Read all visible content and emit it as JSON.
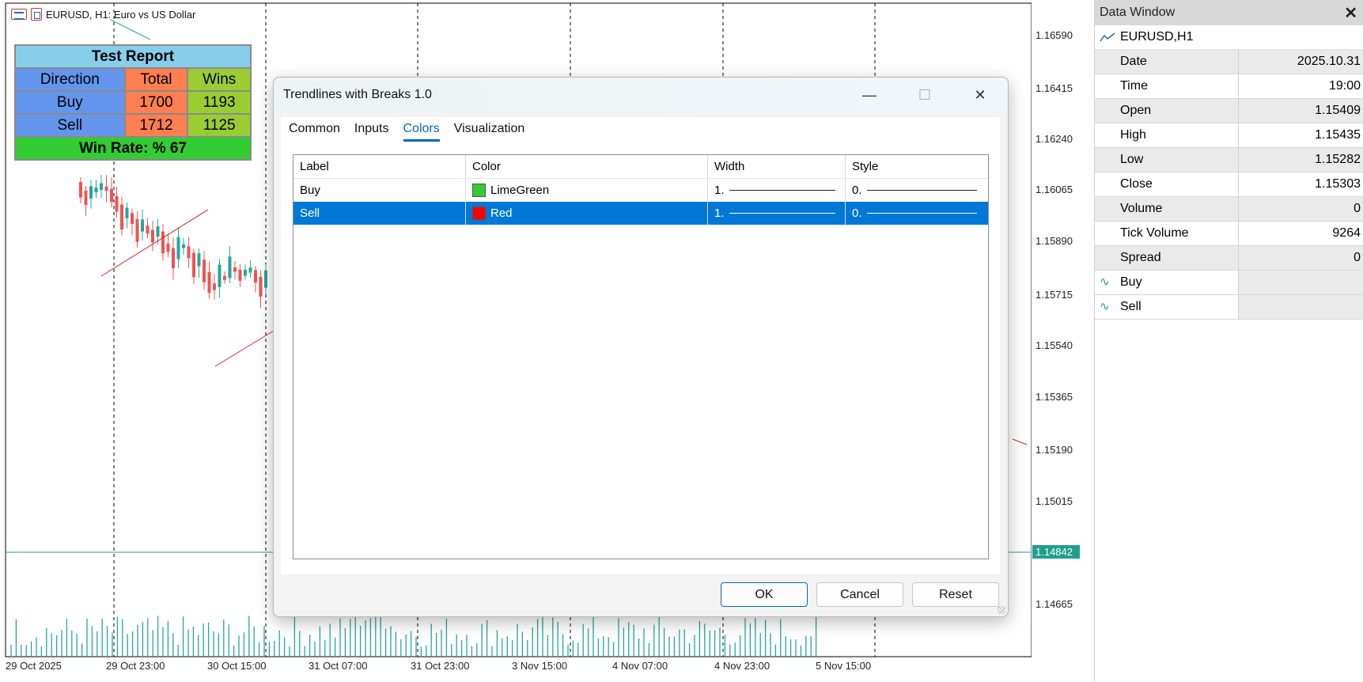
{
  "chart": {
    "symbol_title": "EURUSD, H1:  Euro vs US Dollar",
    "price_labels": [
      "1.16590",
      "1.16415",
      "1.16240",
      "1.16065",
      "1.15890",
      "1.15715",
      "1.15540",
      "1.15365",
      "1.15190",
      "1.15015",
      "1.14665"
    ],
    "current_price": "1.14842",
    "time_labels": [
      "29 Oct 2025",
      "29 Oct 23:00",
      "30 Oct 15:00",
      "31 Oct 07:00",
      "31 Oct 23:00",
      "3 Nov 15:00",
      "4 Nov 07:00",
      "4 Nov 23:00",
      "5 Nov 15:00"
    ],
    "colors": {
      "bull": "#26a69a",
      "bear": "#ef5350",
      "trend": "#e02020",
      "price_line": "#1f9e8e"
    }
  },
  "report": {
    "title": "Test Report",
    "headers": [
      "Direction",
      "Total",
      "Wins"
    ],
    "rows": [
      [
        "Buy",
        "1700",
        "1193"
      ],
      [
        "Sell",
        "1712",
        "1125"
      ]
    ],
    "win_rate": "Win Rate: %  67",
    "colors": {
      "title": "#87ceeb",
      "direction": "#6495ed",
      "total": "#ff7f50",
      "wins": "#9acd32",
      "rate": "#32cd32"
    }
  },
  "data_window": {
    "title": "Data Window",
    "symbol": "EURUSD,H1",
    "rows": [
      {
        "key": "Date",
        "value": "2025.10.31"
      },
      {
        "key": "Time",
        "value": "19:00"
      },
      {
        "key": "Open",
        "value": "1.15409"
      },
      {
        "key": "High",
        "value": "1.15435"
      },
      {
        "key": "Low",
        "value": "1.15282"
      },
      {
        "key": "Close",
        "value": "1.15303"
      },
      {
        "key": "Volume",
        "value": "0"
      },
      {
        "key": "Tick Volume",
        "value": "9264"
      },
      {
        "key": "Spread",
        "value": "0"
      }
    ],
    "indicators": [
      "Buy",
      "Sell"
    ]
  },
  "dialog": {
    "title": "Trendlines with Breaks 1.0",
    "tabs": [
      "Common",
      "Inputs",
      "Colors",
      "Visualization"
    ],
    "active_tab": "Colors",
    "columns": [
      "Label",
      "Color",
      "Width",
      "Style"
    ],
    "rows": [
      {
        "label": "Buy",
        "color_name": "LimeGreen",
        "color": "#32cd32",
        "width": "1.",
        "style": "0."
      },
      {
        "label": "Sell",
        "color_name": "Red",
        "color": "#ff0000",
        "width": "1.",
        "style": "0."
      }
    ],
    "buttons": {
      "ok": "OK",
      "cancel": "Cancel",
      "reset": "Reset"
    }
  }
}
